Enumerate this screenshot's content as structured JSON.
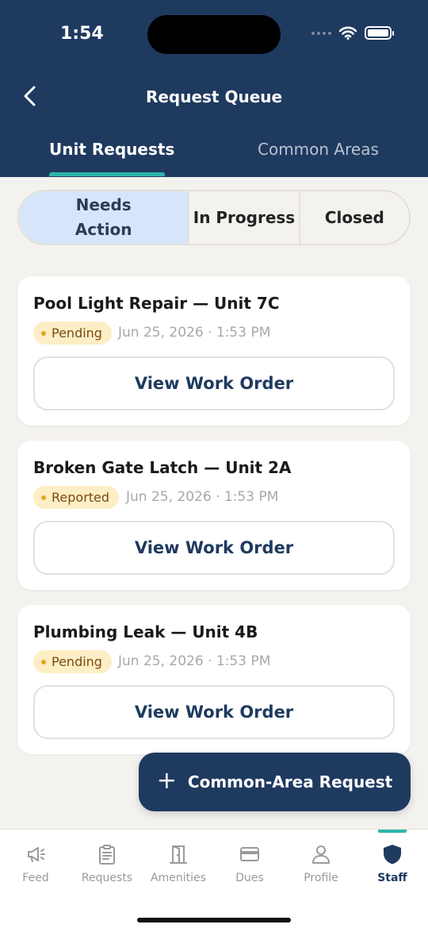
{
  "status_bar": {
    "time": "1:54"
  },
  "header": {
    "title": "Request Queue",
    "tabs": [
      {
        "label": "Unit Requests",
        "active": true
      },
      {
        "label": "Common Areas",
        "active": false
      }
    ]
  },
  "filter": {
    "segments": [
      {
        "label": "Needs Action",
        "active": true
      },
      {
        "label": "In Progress",
        "active": false
      },
      {
        "label": "Closed",
        "active": false
      }
    ]
  },
  "requests": [
    {
      "title": "Pool Light Repair — Unit 7C",
      "status": "Pending",
      "timestamp": "Jun 25, 2026 · 1:53 PM",
      "action": "View Work Order"
    },
    {
      "title": "Broken Gate Latch — Unit 2A",
      "status": "Reported",
      "timestamp": "Jun 25, 2026 · 1:53 PM",
      "action": "View Work Order"
    },
    {
      "title": "Plumbing Leak — Unit 4B",
      "status": "Pending",
      "timestamp": "Jun 25, 2026 · 1:53 PM",
      "action": "View Work Order"
    }
  ],
  "fab": {
    "icon": "plus-icon",
    "label": "Common-Area Request"
  },
  "bottom_nav": [
    {
      "label": "Feed",
      "icon": "megaphone-icon"
    },
    {
      "label": "Requests",
      "icon": "clipboard-icon"
    },
    {
      "label": "Amenities",
      "icon": "door-icon"
    },
    {
      "label": "Dues",
      "icon": "card-icon"
    },
    {
      "label": "Profile",
      "icon": "person-icon"
    },
    {
      "label": "Staff",
      "icon": "shield-icon",
      "active": true
    }
  ],
  "colors": {
    "primary": "#1f3a5f",
    "accent": "#2fb5ad",
    "background": "#f4f2ee",
    "badge_bg": "#fdeec6",
    "badge_dot": "#e7a325",
    "segment_active": "#d7e5fa"
  }
}
